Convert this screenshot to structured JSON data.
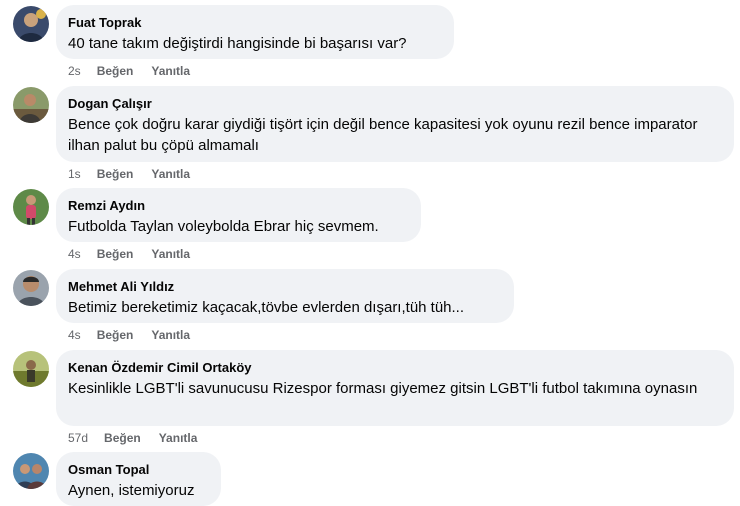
{
  "comments": [
    {
      "author": "Fuat Toprak",
      "text": "40 tane takım değiştirdi hangisinde bi başarısı var?",
      "time": "2s",
      "like": "Beğen",
      "reply": "Yanıtla",
      "avatar_icon": "person-avatar-icon",
      "avatar_color": "#3a4a6b"
    },
    {
      "author": "Dogan Çalışır",
      "text": "Bence çok doğru karar giydiği tişört için değil bence kapasitesi yok oyunu rezil bence imparator ilhan palut bu çöpü almamalı",
      "time": "1s",
      "like": "Beğen",
      "reply": "Yanıtla",
      "avatar_icon": "person-avatar-icon",
      "avatar_color": "#6b5a3e"
    },
    {
      "author": "Remzi Aydın",
      "text": "Futbolda Taylan voleybolda Ebrar hiç sevmem.",
      "time": "4s",
      "like": "Beğen",
      "reply": "Yanıtla",
      "avatar_icon": "person-avatar-icon",
      "avatar_color": "#4d7a3a"
    },
    {
      "author": "Mehmet Ali Yıldız",
      "text": "Betimiz bereketimiz kaçacak,tövbe evlerden dışarı,tüh tüh...",
      "time": "4s",
      "like": "Beğen",
      "reply": "Yanıtla",
      "avatar_icon": "person-avatar-icon",
      "avatar_color": "#5a6270"
    },
    {
      "author": "Kenan Özdemir Cimil Ortaköy",
      "text": "Kesinlikle LGBT'li savunucusu Rizespor forması giyemez gitsin LGBT'li futbol takımına oynasın",
      "time": "57d",
      "like": "Beğen",
      "reply": "Yanıtla",
      "avatar_icon": "person-avatar-icon",
      "avatar_color": "#6f7a2e"
    },
    {
      "author": "Osman Topal",
      "text": "Aynen, istemiyoruz",
      "time": "",
      "like": "",
      "reply": "",
      "avatar_icon": "person-avatar-icon",
      "avatar_color": "#2f5a7a"
    }
  ]
}
